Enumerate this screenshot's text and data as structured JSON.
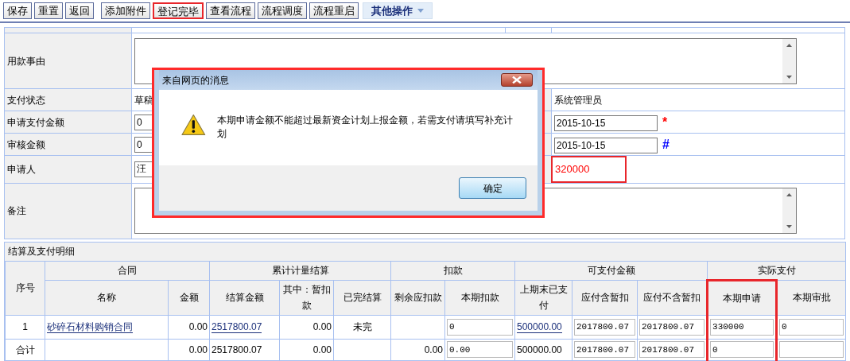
{
  "toolbar": {
    "buttons": [
      {
        "label": "保存",
        "highlighted": false
      },
      {
        "label": "重置",
        "highlighted": false
      },
      {
        "label": "返回",
        "highlighted": false
      },
      {
        "label": "添加附件",
        "highlighted": false
      },
      {
        "label": "登记完毕",
        "highlighted": true
      },
      {
        "label": "查看流程",
        "highlighted": false
      },
      {
        "label": "流程调度",
        "highlighted": false
      },
      {
        "label": "流程重启",
        "highlighted": false
      }
    ],
    "menu": {
      "label": "其他操作"
    }
  },
  "form": {
    "rows": [
      {
        "kind": "textarea",
        "label": "用款事由"
      },
      {
        "kind": "pair",
        "label": "支付状态",
        "value": {
          "kind": "text",
          "text": "草稿"
        },
        "value2": {
          "kind": "text",
          "text": "系统管理员"
        }
      },
      {
        "kind": "pair",
        "label": "申请支付金额",
        "value": {
          "kind": "input",
          "text": "0"
        },
        "value2": {
          "kind": "input",
          "text": "2015-10-15"
        },
        "marker": {
          "text": "*",
          "color": "#ff0000"
        }
      },
      {
        "kind": "pair",
        "label": "审核金额",
        "value": {
          "kind": "input",
          "text": "0"
        },
        "value2": {
          "kind": "input",
          "text": "2015-10-15"
        },
        "marker": {
          "text": "#",
          "color": "#0000ff"
        }
      },
      {
        "kind": "pair",
        "label": "申请人",
        "value": {
          "kind": "input",
          "text": "汪"
        },
        "value2": {
          "kind": "text",
          "text": "320000",
          "highlighted": true
        }
      },
      {
        "kind": "textarea",
        "label": "备注"
      }
    ]
  },
  "dialog": {
    "title": "来自网页的消息",
    "message": "本期申请金额不能超过最新资金计划上报金额，若需支付请填写补充计划",
    "button": "确定"
  },
  "detail": {
    "title": "结算及支付明细",
    "groups": [
      {
        "label": "序号"
      },
      {
        "label": "合同",
        "columns": [
          {
            "label": "名称",
            "highlighted": false
          },
          {
            "label": "金额",
            "highlighted": false
          }
        ]
      },
      {
        "label": "累计计量结算",
        "columns": [
          {
            "label": "结算金额",
            "highlighted": false
          },
          {
            "label": "其中：暂扣款",
            "highlighted": false
          },
          {
            "label": "已完结算",
            "highlighted": false
          }
        ]
      },
      {
        "label": "扣款",
        "columns": [
          {
            "label": "剩余应扣款",
            "highlighted": false
          },
          {
            "label": "本期扣款",
            "highlighted": false
          }
        ]
      },
      {
        "label": "可支付金额",
        "columns": [
          {
            "label": "上期末已支付",
            "highlighted": false
          },
          {
            "label": "应付含暂扣",
            "highlighted": false
          },
          {
            "label": "应付不含暂扣",
            "highlighted": false
          }
        ]
      },
      {
        "label": "实际支付",
        "columns": [
          {
            "label": "本期申请",
            "highlighted": true
          },
          {
            "label": "本期审批",
            "highlighted": false
          }
        ]
      }
    ],
    "rows": [
      {
        "cells": [
          {
            "kind": "text",
            "text": "1"
          },
          {
            "kind": "link",
            "text": "砂碎石材料购销合同"
          },
          {
            "kind": "text",
            "text": "0.00"
          },
          {
            "kind": "link",
            "text": "2517800.07"
          },
          {
            "kind": "text",
            "text": "0.00"
          },
          {
            "kind": "text",
            "text": "未完"
          },
          {
            "kind": "empty"
          },
          {
            "kind": "input",
            "text": "0"
          },
          {
            "kind": "link",
            "text": "500000.00"
          },
          {
            "kind": "input",
            "text": "2017800.07"
          },
          {
            "kind": "input",
            "text": "2017800.07"
          },
          {
            "kind": "input",
            "text": "330000"
          },
          {
            "kind": "input",
            "text": "0"
          }
        ]
      },
      {
        "cells": [
          {
            "kind": "text",
            "text": "合计"
          },
          {
            "kind": "empty"
          },
          {
            "kind": "text",
            "text": "0.00"
          },
          {
            "kind": "text",
            "text": "2517800.07"
          },
          {
            "kind": "text",
            "text": "0.00"
          },
          {
            "kind": "empty"
          },
          {
            "kind": "text",
            "text": "0.00"
          },
          {
            "kind": "input",
            "text": "0.00"
          },
          {
            "kind": "text",
            "text": "500000.00"
          },
          {
            "kind": "input",
            "text": "2017800.07"
          },
          {
            "kind": "input",
            "text": "2017800.07"
          },
          {
            "kind": "input",
            "text": "0"
          },
          {
            "kind": "input",
            "text": ""
          }
        ]
      }
    ]
  }
}
